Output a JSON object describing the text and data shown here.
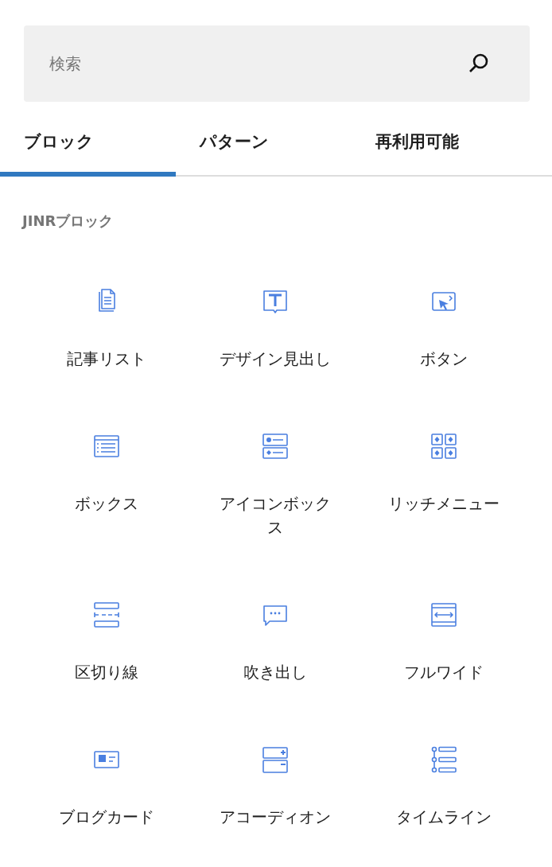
{
  "search": {
    "placeholder": "検索"
  },
  "tabs": [
    {
      "label": "ブロック",
      "selected": true
    },
    {
      "label": "パターン",
      "selected": false
    },
    {
      "label": "再利用可能",
      "selected": false
    }
  ],
  "section": {
    "title": "JINRブロック"
  },
  "blocks": [
    {
      "label": "記事リスト"
    },
    {
      "label": "デザイン見出し"
    },
    {
      "label": "ボタン"
    },
    {
      "label": "ボックス"
    },
    {
      "label": "アイコンボックス"
    },
    {
      "label": "リッチメニュー"
    },
    {
      "label": "区切り線"
    },
    {
      "label": "吹き出し"
    },
    {
      "label": "フルワイド"
    },
    {
      "label": "ブログカード"
    },
    {
      "label": "アコーディオン"
    },
    {
      "label": "タイムライン"
    }
  ]
}
